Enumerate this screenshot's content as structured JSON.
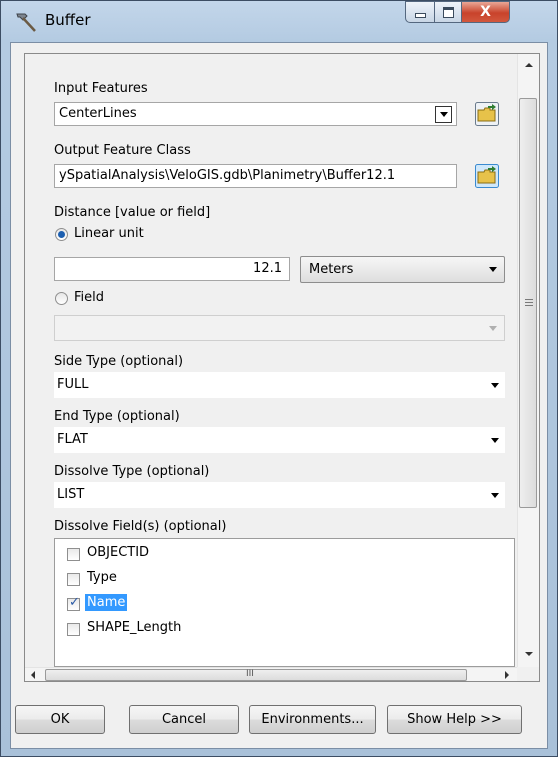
{
  "window": {
    "title": "Buffer",
    "controls": {
      "minimize": "minimize",
      "maximize": "maximize",
      "close": "X"
    },
    "accent": "#3399ff"
  },
  "form": {
    "input_features": {
      "label": "Input Features",
      "value": "CenterLines"
    },
    "output_feature_class": {
      "label": "Output Feature Class",
      "value": "ySpatialAnalysis\\VeloGIS.gdb\\Planimetry\\Buffer12.1"
    },
    "distance": {
      "label": "Distance [value or field]",
      "linear_unit_label": "Linear unit",
      "linear_unit_selected": true,
      "value": "12.1",
      "unit": "Meters",
      "field_label": "Field",
      "field_selected": false,
      "field_value": ""
    },
    "side_type": {
      "label": "Side Type (optional)",
      "value": "FULL"
    },
    "end_type": {
      "label": "End Type (optional)",
      "value": "FLAT"
    },
    "dissolve_type": {
      "label": "Dissolve Type (optional)",
      "value": "LIST"
    },
    "dissolve_fields": {
      "label": "Dissolve Field(s) (optional)",
      "items": [
        {
          "label": "OBJECTID",
          "checked": false
        },
        {
          "label": "Type",
          "checked": false
        },
        {
          "label": "Name",
          "checked": true,
          "selected": true
        },
        {
          "label": "SHAPE_Length",
          "checked": false
        }
      ]
    }
  },
  "scrollbars": {
    "h_grip": "III"
  },
  "buttons": {
    "ok": "OK",
    "cancel": "Cancel",
    "environments": "Environments...",
    "show_help": "Show Help >>"
  }
}
